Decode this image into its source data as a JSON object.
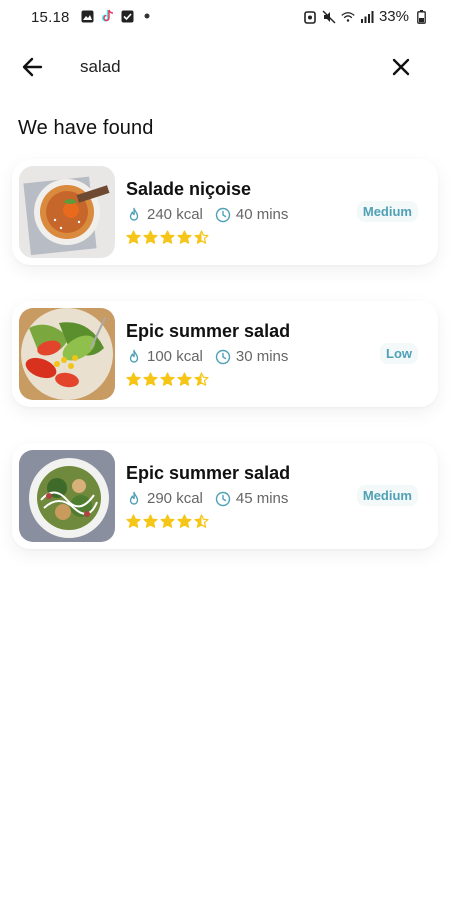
{
  "status_bar": {
    "time": "15.18",
    "battery": "33%",
    "left_icons": [
      "image-icon",
      "tiktok-icon",
      "check-box-icon",
      "dot-icon"
    ],
    "right_icons": [
      "data-saver-icon",
      "mute-icon",
      "wifi-icon",
      "signal-icon",
      "battery-icon"
    ]
  },
  "search": {
    "value": "salad",
    "back_icon": "arrow-left-icon",
    "clear_icon": "close-icon"
  },
  "results": {
    "heading": "We have found",
    "items": [
      {
        "title": "Salade niçoise",
        "calories": "240 kcal",
        "duration": "40 mins",
        "difficulty": "Medium",
        "rating": 4.5,
        "thumb": "dessert-bowl"
      },
      {
        "title": "Epic summer salad",
        "calories": "100 kcal",
        "duration": "30 mins",
        "difficulty": "Low",
        "rating": 4.5,
        "thumb": "tomato-avocado-salad"
      },
      {
        "title": "Epic summer salad",
        "calories": "290 kcal",
        "duration": "45 mins",
        "difficulty": "Medium",
        "rating": 4.5,
        "thumb": "green-salad-plate"
      }
    ]
  },
  "colors": {
    "accent": "#4fa1b6",
    "star": "#f5c518",
    "meta_icon": "#4fa1b6",
    "badge_bg": "#f3f8f9"
  }
}
